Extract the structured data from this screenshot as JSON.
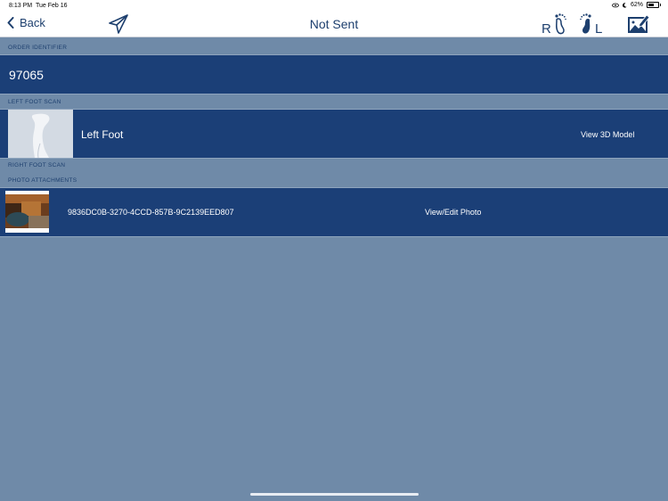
{
  "status_bar": {
    "time": "8:13 PM",
    "date": "Tue Feb 16",
    "battery_percent": "62%",
    "battery_level": 0.62
  },
  "navbar": {
    "back_label": "Back",
    "title": "Not Sent",
    "right_foot_letter": "R",
    "left_foot_letter": "L",
    "icons": [
      "chevron-left-icon",
      "paper-plane-icon",
      "right-foot-icon",
      "left-foot-icon",
      "photo-edit-icon"
    ]
  },
  "order": {
    "header": "ORDER IDENTIFIER",
    "value": "97065"
  },
  "left_scan": {
    "header": "LEFT FOOT SCAN",
    "label": "Left Foot",
    "action": "View 3D Model"
  },
  "right_scan": {
    "header": "RIGHT FOOT SCAN"
  },
  "photos": {
    "header": "PHOTO ATTACHMENTS",
    "items": [
      {
        "id": "9836DC0B-3270-4CCD-857B-9C2139EED807",
        "action": "View/Edit Photo"
      }
    ]
  },
  "colors": {
    "background": "#6f8aa8",
    "row": "#1b3f77",
    "accent": "#1d3f6e"
  }
}
